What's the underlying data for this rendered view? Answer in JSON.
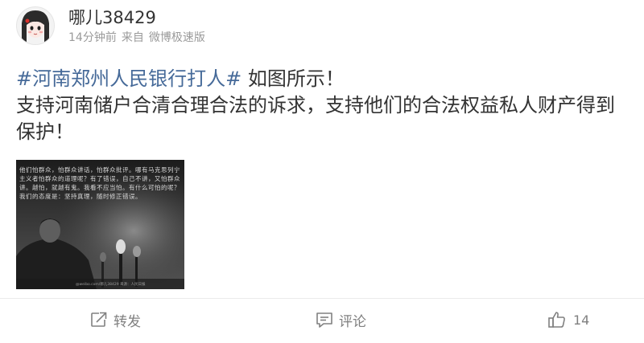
{
  "user": {
    "name": "哪儿38429"
  },
  "meta": {
    "time": "14分钟前",
    "via_prefix": "来自",
    "source": "微博极速版"
  },
  "post": {
    "hashtag": "#河南郑州人民银行打人#",
    "line1_rest": " 如图所示！",
    "line2": "支持河南储户合清合理合法的诉求，支持他们的合法权益私人财产得到保护！"
  },
  "image": {
    "quote": "他们怕群众，怕群众讲话，怕群众批评。哪有马克思列宁主义者怕群众的道理呢？有了错误，自己不讲，又怕群众讲。越怕，就越有鬼。我看不应当怕。有什么可怕的呢？我们的态度是：坚持真理，随时修正错误。",
    "caption": "@weibo.com/哪儿38429    来源：人民日报"
  },
  "actions": {
    "repost_label": "转发",
    "comment_label": "评论",
    "like_count": "14"
  },
  "colors": {
    "hashtag": "#466a99",
    "text": "#333333",
    "meta": "#9a9a9a",
    "action": "#808080"
  }
}
